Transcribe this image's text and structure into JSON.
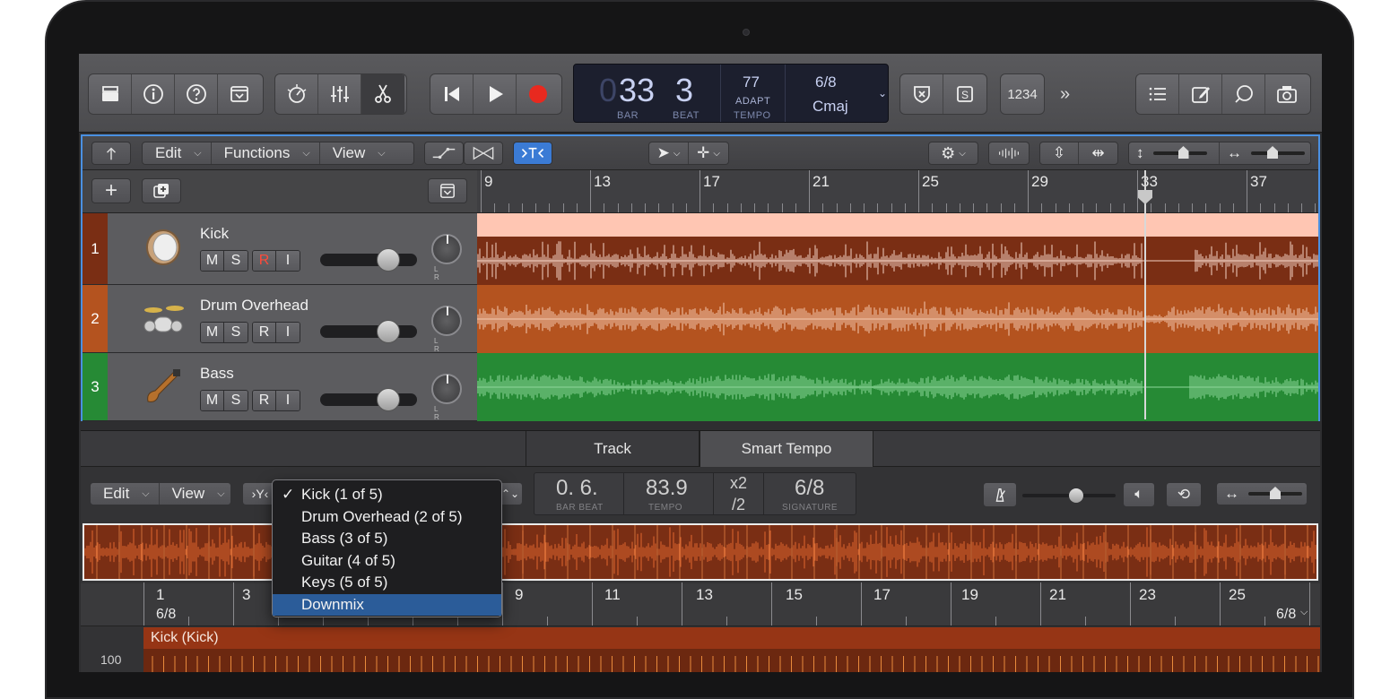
{
  "transport": {
    "bar": "33",
    "beat": "3",
    "bar_label": "BAR",
    "beat_label": "BEAT",
    "tempo": "77",
    "tempo_mode": "ADAPT",
    "tempo_label": "TEMPO",
    "signature": "6/8",
    "key": "Cmaj",
    "count_in": "1234"
  },
  "tracks_toolbar": {
    "edit": "Edit",
    "functions": "Functions",
    "view": "View"
  },
  "ruler": [
    "9",
    "13",
    "17",
    "21",
    "25",
    "29",
    "33",
    "37"
  ],
  "tracks": [
    {
      "num": "1",
      "name": "Kick",
      "m": "M",
      "s": "S",
      "r": "R",
      "i": "I",
      "color": "#7a2e14",
      "header": "#ffc6b3",
      "wave": "#f4d2c4"
    },
    {
      "num": "2",
      "name": "Drum Overhead",
      "m": "M",
      "s": "S",
      "r": "R",
      "i": "I",
      "color": "#b4531f",
      "wave": "#f4c9b0"
    },
    {
      "num": "3",
      "name": "Bass",
      "m": "M",
      "s": "S",
      "r": "R",
      "i": "I",
      "color": "#268a35",
      "wave": "#8ed89a"
    }
  ],
  "pan_lr": "L R",
  "editor": {
    "tabs": [
      "Track",
      "Smart Tempo"
    ],
    "edit": "Edit",
    "view": "View",
    "lcd": {
      "pos": "0. 6.",
      "pos_label": "BAR  BEAT",
      "tempo": "83.9",
      "tempo_label": "TEMPO",
      "x2": "x2",
      "half": "/2",
      "signature": "6/8",
      "signature_label": "SIGNATURE"
    },
    "ruler": [
      "1",
      "3",
      "9",
      "11",
      "13",
      "15",
      "17",
      "19",
      "21",
      "23",
      "25"
    ],
    "signature_start": "6/8",
    "signature_end": "6/8",
    "region": "Kick (Kick)",
    "y_value": "100"
  },
  "dropdown": {
    "items": [
      "Kick (1 of 5)",
      "Drum Overhead (2 of 5)",
      "Bass (3 of 5)",
      "Guitar (4 of 5)",
      "Keys (5 of 5)",
      "Downmix"
    ],
    "checked": "✓",
    "highlighted": 5
  }
}
